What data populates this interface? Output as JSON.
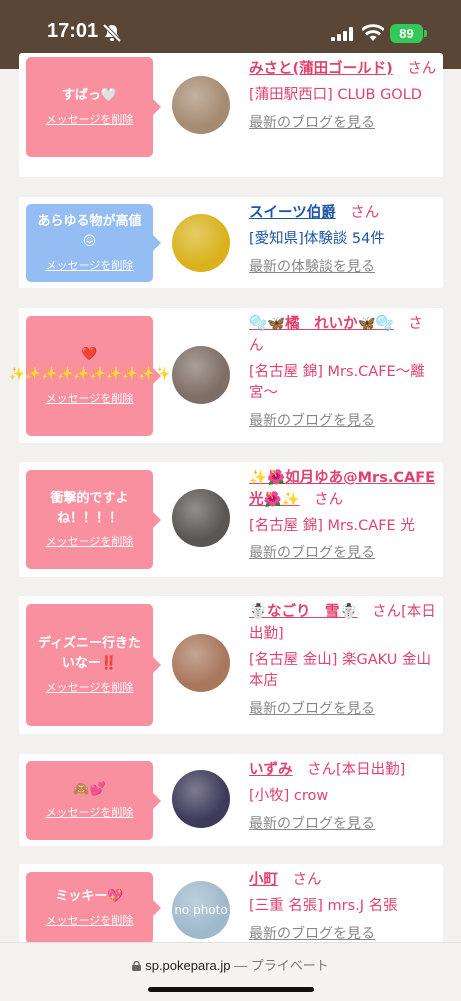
{
  "status": {
    "time": "17:01",
    "battery": "89"
  },
  "browser": {
    "domain": "sp.pokepara.jp",
    "separator": "—",
    "mode": "プライベート"
  },
  "delete_label": "メッセージを削除",
  "cards": [
    {
      "message": "すばっ🤍",
      "color": "pink",
      "name": "みさと(蒲田ゴールド)",
      "suffix": "さん",
      "place": "[蒲田駅西口] CLUB GOLD",
      "link": "最新のブログを見る",
      "avatar_color": "#a48b72"
    },
    {
      "message": "あらゆる物が高値😖",
      "color": "blue",
      "name": "スイーツ伯爵",
      "suffix": "さん",
      "place": "[愛知県]体験談 54件",
      "link": "最新の体験談を見る",
      "avatar_color": "#d9b21c"
    },
    {
      "message": "❤️ ✨✨✨✨✨✨✨✨✨✨",
      "color": "pink",
      "name": "🫧🦋橘　れいか🦋🫧",
      "suffix": "さん",
      "place": "[名古屋 錦] Mrs.CAFE〜離宮〜",
      "link": "最新のブログを見る",
      "avatar_color": "#7e6e66"
    },
    {
      "message": "衝撃的ですよね！！！！",
      "color": "pink",
      "name": "✨🌺如月ゆあ@Mrs.CAFE光🌺✨",
      "suffix": "さん",
      "place": "[名古屋 錦] Mrs.CAFE 光",
      "link": "最新のブログを見る",
      "avatar_color": "#5a5652"
    },
    {
      "message": "ディズニー行きたいなー‼️",
      "color": "pink",
      "name": "☃️なごり　雪☃️",
      "suffix": "さん[本日出勤]",
      "place": "[名古屋 金山] 楽GAKU 金山本店",
      "link": "最新のブログを見る",
      "avatar_color": "#a8775d"
    },
    {
      "message": "🙈💕",
      "color": "pink",
      "name": "いずみ",
      "suffix": "さん[本日出勤]",
      "place": "[小牧] crow",
      "link": "最新のブログを見る",
      "avatar_color": "#3e3a5a"
    },
    {
      "message": "ミッキー💖",
      "color": "pink",
      "name": "小町",
      "suffix": "さん",
      "place": "[三重 名張] mrs.J 名張",
      "link": "最新のブログを見る",
      "avatar_color": "#9fb9cc",
      "avatar_text": "no photo"
    }
  ]
}
